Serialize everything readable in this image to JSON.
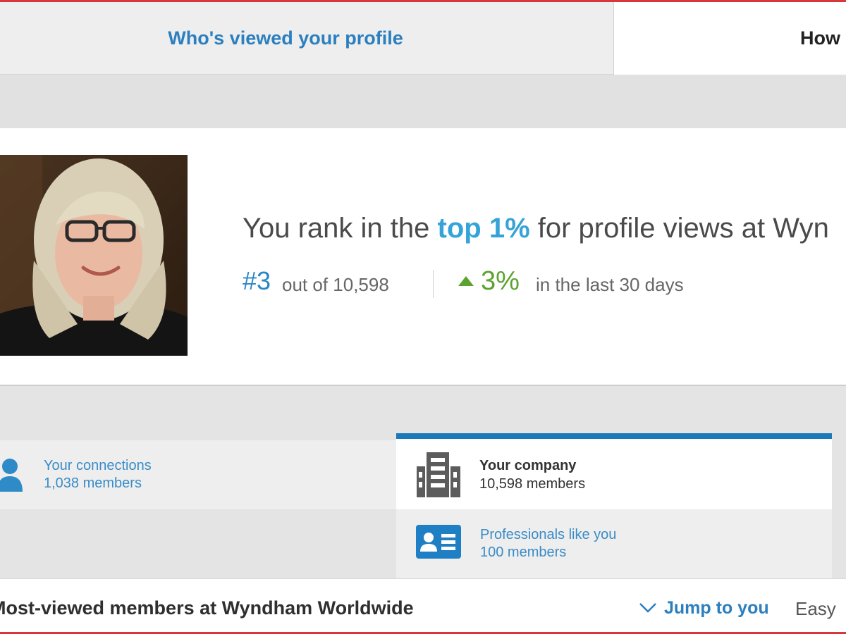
{
  "tabs": {
    "left": {
      "label": "Who's viewed your profile"
    },
    "right": {
      "label": "How y"
    }
  },
  "rank": {
    "prefix": "You rank in the",
    "highlight": "top 1%",
    "suffix": "for profile views at Wyn",
    "position": "#3",
    "out_of": "out of 10,598",
    "change": "3%",
    "period": "in the last 30 days"
  },
  "filters": {
    "connections": {
      "label": "Your connections",
      "count": "1,038 members"
    },
    "company": {
      "label": "Your company",
      "count": "10,598 members"
    },
    "professionals": {
      "label": "Professionals like you",
      "count": "100 members"
    }
  },
  "list": {
    "title": "Most-viewed members at Wyndham Worldwide",
    "jump_label": "Jump to you",
    "right_text": "Easy"
  },
  "colors": {
    "link_blue": "#2b7fbf",
    "highlight_blue": "#36a3d8",
    "up_green": "#5aa32f",
    "active_tab_border": "#1b78b9",
    "frame_red": "#d9363e"
  },
  "icons": {
    "connections": "person-icon",
    "company": "building-icon",
    "professionals": "id-card-icon",
    "jump": "chevron-down-icon",
    "change": "up-arrow-icon"
  }
}
